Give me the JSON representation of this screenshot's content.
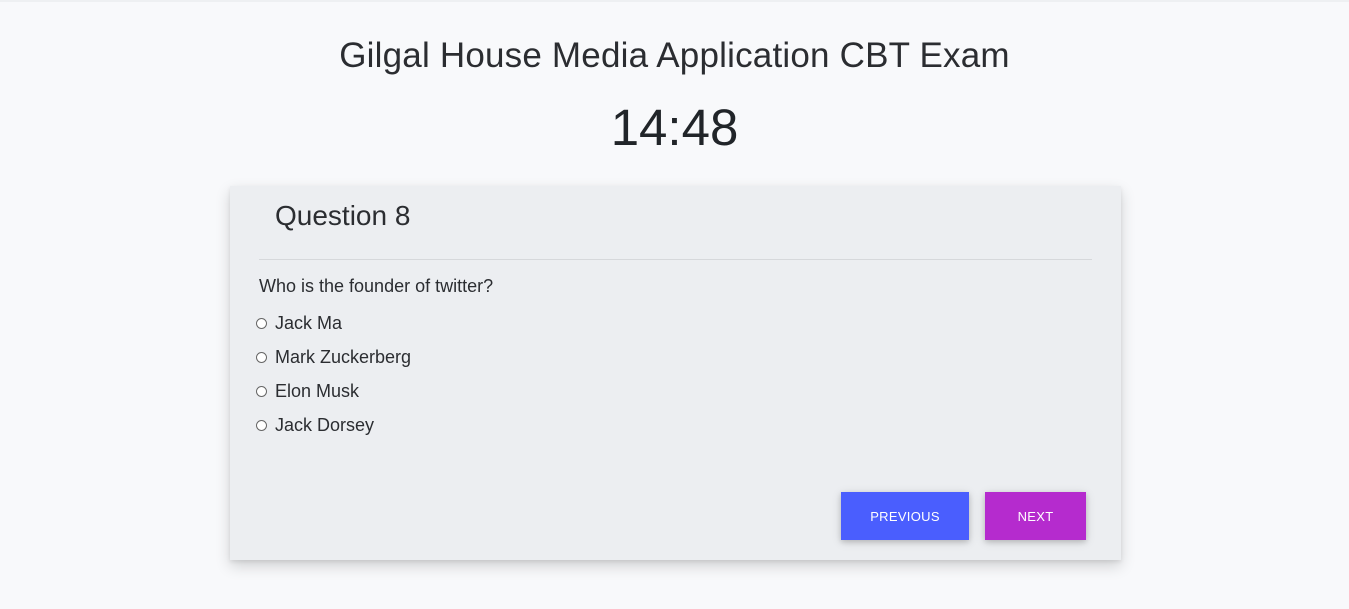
{
  "exam": {
    "title": "Gilgal House Media Application CBT Exam",
    "timer": "14:48"
  },
  "question": {
    "heading": "Question 8",
    "text": "Who is the founder of twitter?",
    "options": [
      {
        "label": "Jack Ma",
        "selected": false
      },
      {
        "label": "Mark Zuckerberg",
        "selected": false
      },
      {
        "label": "Elon Musk",
        "selected": false
      },
      {
        "label": "Jack Dorsey",
        "selected": false
      }
    ]
  },
  "buttons": {
    "previous_label": "PREVIOUS",
    "next_label": "NEXT"
  },
  "colors": {
    "previous_button": "#4a5efe",
    "next_button": "#b52bce",
    "page_background": "#f8f9fb",
    "card_background": "#eceef1"
  }
}
